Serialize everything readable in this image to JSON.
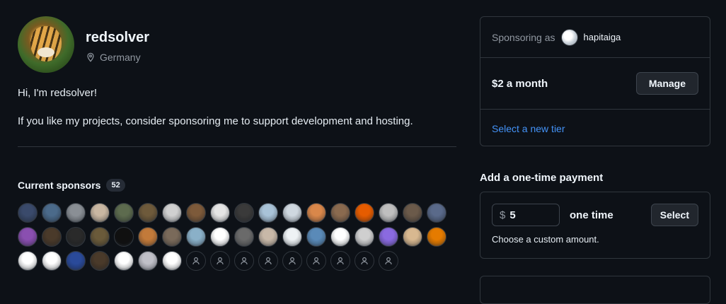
{
  "profile": {
    "username": "redsolver",
    "location": "Germany",
    "bio_line1": "Hi, I'm redsolver!",
    "bio_line2": "If you like my projects, consider sponsoring me to support development and hosting."
  },
  "sponsors": {
    "title": "Current sponsors",
    "count": "52",
    "avatar_colors": [
      "#3a4a6b",
      "#4b6a8a",
      "#8a8f95",
      "#c9b7a2",
      "#5d6b4e",
      "#6e5a3b",
      "#d0d0d0",
      "#7d5a3a",
      "#e5e5e5",
      "#3a3a3a",
      "#a9c3d8",
      "#cfd8e0",
      "#d9874a",
      "#8a6a4f",
      "#e65c00",
      "#bfbfbf",
      "#6b5a4a",
      "#5a6a8a",
      "#8a4fb0",
      "#4a3a2a",
      "#2a2a2a",
      "#6a5a3a",
      "#101010",
      "#c27a3a",
      "#7a6a5a",
      "#8ab0c8",
      "#ffffff",
      "#6a6a6a",
      "#c8b8a8",
      "#eef2f5",
      "#5a8ab8",
      "#ffffff",
      "#cfcfcf",
      "#8a6ae0",
      "#d8b890",
      "#e57b00",
      "#ffffff",
      "#ffffff",
      "#2a4a9a",
      "#4a3a2a",
      "#ffffff",
      "#c0c0c8",
      "#ffffff"
    ],
    "placeholder_count": 9
  },
  "sponsoring_card": {
    "label": "Sponsoring as",
    "as_user": "hapitaiga",
    "tier_price": "$2 a month",
    "manage_label": "Manage",
    "new_tier_link": "Select a new tier"
  },
  "onetime": {
    "title": "Add a one-time payment",
    "currency_symbol": "$",
    "amount": "5",
    "frequency_label": "one time",
    "select_label": "Select",
    "note": "Choose a custom amount."
  }
}
